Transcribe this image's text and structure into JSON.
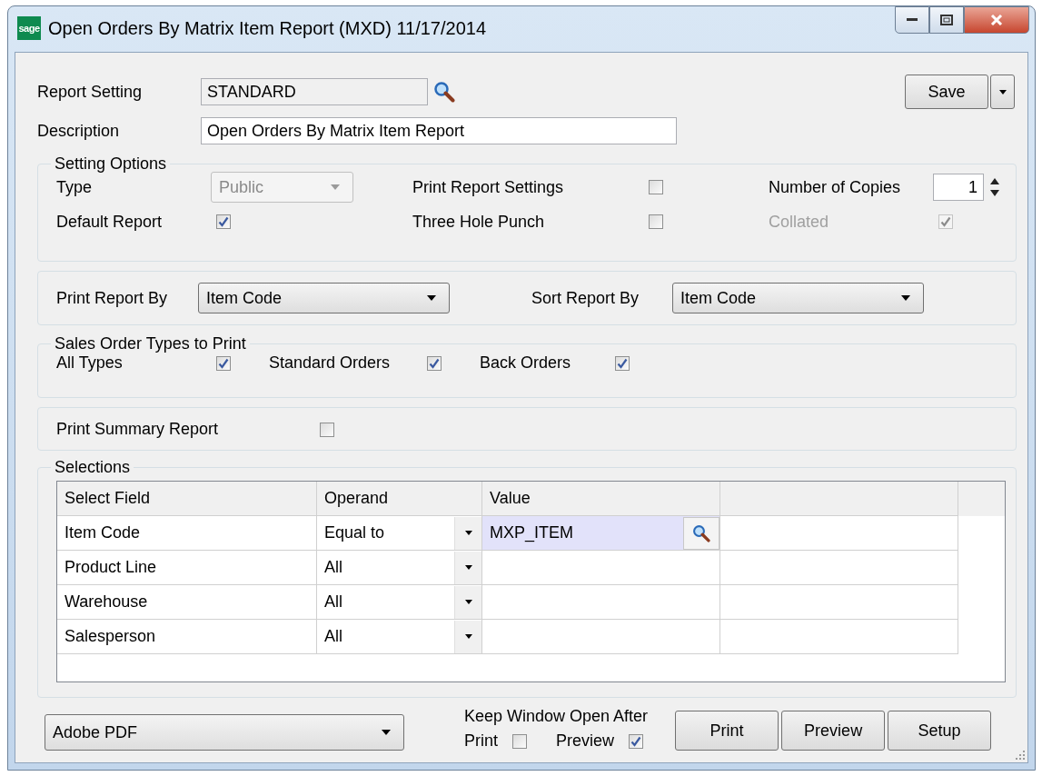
{
  "window": {
    "logo": "sage",
    "title": "Open Orders By Matrix Item Report (MXD) 11/17/2014"
  },
  "report_setting": {
    "label": "Report Setting",
    "value": "STANDARD"
  },
  "save_button": {
    "label": "Save"
  },
  "description": {
    "label": "Description",
    "value": "Open Orders By Matrix Item Report"
  },
  "setting_options": {
    "title": "Setting Options",
    "type": {
      "label": "Type",
      "value": "Public",
      "disabled": true
    },
    "print_report_settings": {
      "label": "Print Report Settings",
      "checked": false,
      "disabled": false
    },
    "number_of_copies": {
      "label": "Number of Copies",
      "value": "1"
    },
    "default_report": {
      "label": "Default Report",
      "checked": true,
      "disabled": false
    },
    "three_hole_punch": {
      "label": "Three Hole Punch",
      "checked": false,
      "disabled": false
    },
    "collated": {
      "label": "Collated",
      "checked": true,
      "disabled": true
    }
  },
  "print_report_by": {
    "label": "Print Report By",
    "value": "Item Code"
  },
  "sort_report_by": {
    "label": "Sort Report By",
    "value": "Item Code"
  },
  "sales_order_types": {
    "title": "Sales Order Types to Print",
    "items": [
      {
        "label": "All Types",
        "checked": true
      },
      {
        "label": "Standard Orders",
        "checked": true
      },
      {
        "label": "Back Orders",
        "checked": true
      }
    ]
  },
  "print_summary_report": {
    "label": "Print Summary Report",
    "checked": false
  },
  "selections": {
    "title": "Selections",
    "columns": [
      "Select Field",
      "Operand",
      "Value"
    ],
    "rows": [
      {
        "field": "Item Code",
        "operand": "Equal to",
        "value": "MXP_ITEM",
        "selected": true
      },
      {
        "field": "Product Line",
        "operand": "All",
        "selected": false
      },
      {
        "field": "Warehouse",
        "operand": "All",
        "selected": false
      },
      {
        "field": "Salesperson",
        "operand": "All",
        "selected": false
      }
    ]
  },
  "printer": {
    "value": "Adobe PDF"
  },
  "keep_open": {
    "label": "Keep Window Open After",
    "options": [
      {
        "label": "Print",
        "checked": false
      },
      {
        "label": "Preview",
        "checked": true
      }
    ]
  },
  "buttons": [
    "Print",
    "Preview",
    "Setup"
  ]
}
